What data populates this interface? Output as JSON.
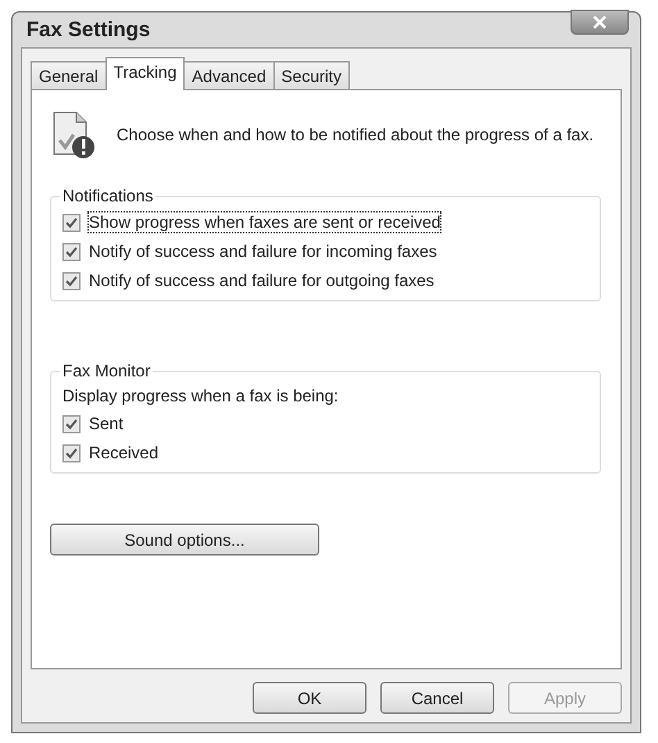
{
  "window": {
    "title": "Fax Settings"
  },
  "tabs": [
    {
      "label": "General",
      "selected": false
    },
    {
      "label": "Tracking",
      "selected": true
    },
    {
      "label": "Advanced",
      "selected": false
    },
    {
      "label": "Security",
      "selected": false
    }
  ],
  "intro": "Choose when and how to be notified about the progress of a fax.",
  "notifications": {
    "title": "Notifications",
    "options": [
      {
        "label": "Show progress when faxes are sent or received",
        "checked": true,
        "focused": true
      },
      {
        "label": "Notify of success and failure for incoming faxes",
        "checked": true,
        "focused": false
      },
      {
        "label": "Notify of success and failure for outgoing faxes",
        "checked": true,
        "focused": false
      }
    ]
  },
  "fax_monitor": {
    "title": "Fax Monitor",
    "description": "Display progress when a fax is being:",
    "options": [
      {
        "label": "Sent",
        "checked": true
      },
      {
        "label": "Received",
        "checked": true
      }
    ]
  },
  "sound_button": "Sound options...",
  "buttons": [
    {
      "label": "OK",
      "disabled": false
    },
    {
      "label": "Cancel",
      "disabled": false
    },
    {
      "label": "Apply",
      "disabled": true
    }
  ]
}
